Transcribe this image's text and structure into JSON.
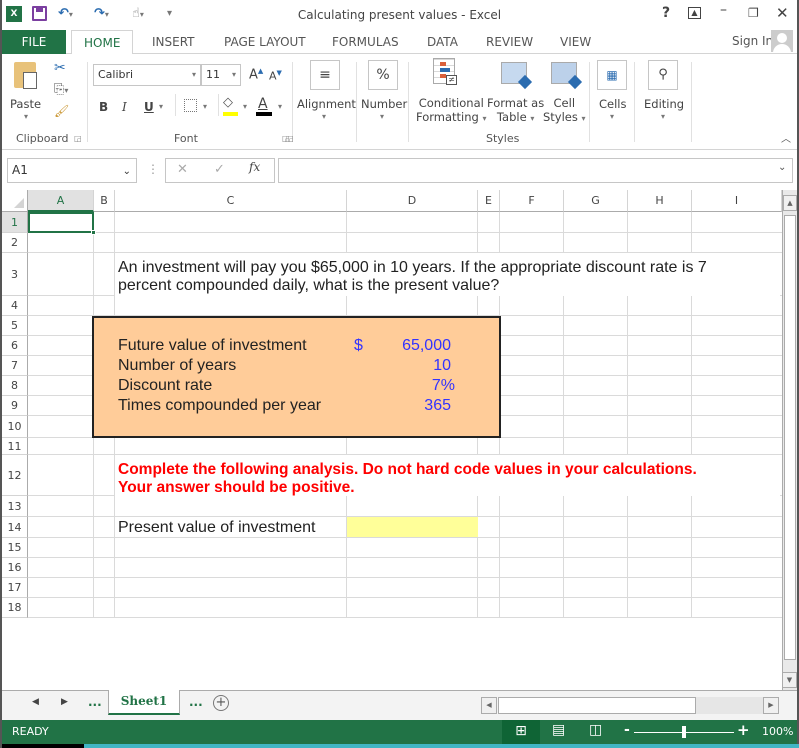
{
  "window": {
    "title": "Calculating present values - Excel",
    "help_label": "?",
    "icons": [
      "excel-logo-icon",
      "save-icon",
      "undo-icon",
      "redo-icon",
      "touch-mode-icon",
      "customize-qat-icon",
      "ribbon-display-icon",
      "minimize-icon",
      "restore-icon",
      "close-icon"
    ]
  },
  "tabs": [
    {
      "label": "FILE"
    },
    {
      "label": "HOME",
      "active": true
    },
    {
      "label": "INSERT"
    },
    {
      "label": "PAGE LAYOUT"
    },
    {
      "label": "FORMULAS"
    },
    {
      "label": "DATA"
    },
    {
      "label": "REVIEW"
    },
    {
      "label": "VIEW"
    }
  ],
  "account": {
    "sign_in_label": "Sign In"
  },
  "ribbon": {
    "clipboard": {
      "paste_label": "Paste",
      "group_label": "Clipboard"
    },
    "font": {
      "font_name": "Calibri",
      "font_size": "11",
      "bold": "B",
      "italic": "I",
      "underline": "U",
      "grow": "A",
      "shrink": "A",
      "font_color_glyph": "A",
      "group_label": "Font",
      "fill_color": "#ffff00",
      "font_color": "#000000"
    },
    "alignment": {
      "label": "Alignment"
    },
    "number": {
      "label": "Number",
      "glyph": "%"
    },
    "styles": {
      "conditional_l1": "Conditional",
      "conditional_l2": "Formatting",
      "format_table_l1": "Format as",
      "format_table_l2": "Table",
      "cell_styles_l1": "Cell",
      "cell_styles_l2": "Styles",
      "group_label": "Styles"
    },
    "cells": {
      "label": "Cells"
    },
    "editing": {
      "label": "Editing"
    }
  },
  "formula_bar": {
    "name_box": "A1",
    "cancel": "✕",
    "enter": "✓",
    "fx": "fx",
    "formula": ""
  },
  "columns": [
    "A",
    "B",
    "C",
    "D",
    "E",
    "F",
    "G",
    "H",
    "I"
  ],
  "rows": [
    "1",
    "2",
    "3",
    "4",
    "5",
    "6",
    "7",
    "8",
    "9",
    "10",
    "11",
    "12",
    "13",
    "14",
    "15",
    "16",
    "17",
    "18"
  ],
  "sheet": {
    "question_line1": "An investment will pay you $65,000 in 10 years. If the appropriate discount rate is 7",
    "question_line2": "percent compounded daily, what is the present value?",
    "inputs": [
      {
        "label": "Future value of investment",
        "currency": "$",
        "value": "65,000"
      },
      {
        "label": "Number of years",
        "currency": "",
        "value": "10"
      },
      {
        "label": "Discount rate",
        "currency": "",
        "value": "7%"
      },
      {
        "label": "Times compounded per year",
        "currency": "",
        "value": "365"
      }
    ],
    "instruction_line1": "Complete the following analysis. Do not hard code values in your calculations.",
    "instruction_line2": "Your answer should be positive.",
    "output_label": "Present value of investment",
    "output_value": "",
    "input_box_color": "#ffcc99",
    "answer_cell_color": "#ffff99"
  },
  "sheet_tabs": {
    "active": "Sheet1",
    "more_left": "...",
    "more_right": "..."
  },
  "status": {
    "mode": "READY",
    "zoom": "100%",
    "zoom_level_percent": 100
  }
}
